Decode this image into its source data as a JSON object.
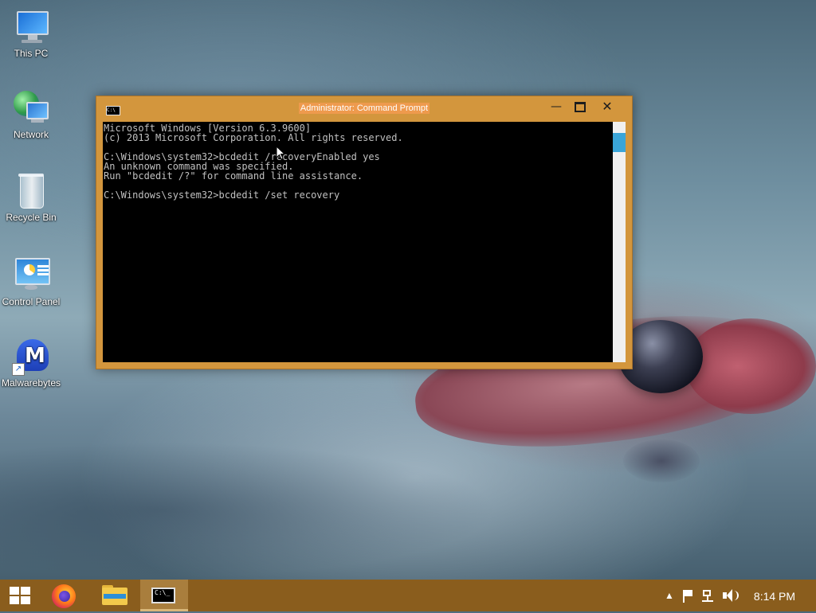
{
  "desktop": {
    "icons": [
      {
        "label": "This PC",
        "icon": "this-pc-icon"
      },
      {
        "label": "Network",
        "icon": "network-icon"
      },
      {
        "label": "Recycle Bin",
        "icon": "recycle-bin-icon"
      },
      {
        "label": "Control Panel",
        "icon": "control-panel-icon"
      },
      {
        "label": "Malwarebytes",
        "icon": "malwarebytes-icon"
      }
    ]
  },
  "cmd_window": {
    "title": "Administrator: Command Prompt",
    "app_icon_text": "C:\\",
    "minimize_label": "—",
    "close_label": "✕",
    "console_lines": [
      "Microsoft Windows [Version 6.3.9600]",
      "(c) 2013 Microsoft Corporation. All rights reserved.",
      "",
      "C:\\Windows\\system32>bcdedit /recoveryEnabled yes",
      "An unknown command was specified.",
      "Run \"bcdedit /?\" for command line assistance.",
      "",
      "C:\\Windows\\system32>bcdedit /set recovery"
    ]
  },
  "taskbar": {
    "items": [
      {
        "name": "start",
        "icon": "windows-logo-icon"
      },
      {
        "name": "firefox",
        "icon": "firefox-icon"
      },
      {
        "name": "file-explorer",
        "icon": "folder-icon"
      },
      {
        "name": "command-prompt",
        "icon": "cmd-icon",
        "active": true
      }
    ],
    "cmd_icon_text": "C:\\_",
    "tray": {
      "chevron": "▲",
      "clock": "8:14 PM"
    }
  },
  "colors": {
    "window_accent": "#d3963d",
    "taskbar": "#8a5d1d",
    "title_highlight": "#ee9a4d",
    "scroll_thumb": "#3aa5d8"
  }
}
